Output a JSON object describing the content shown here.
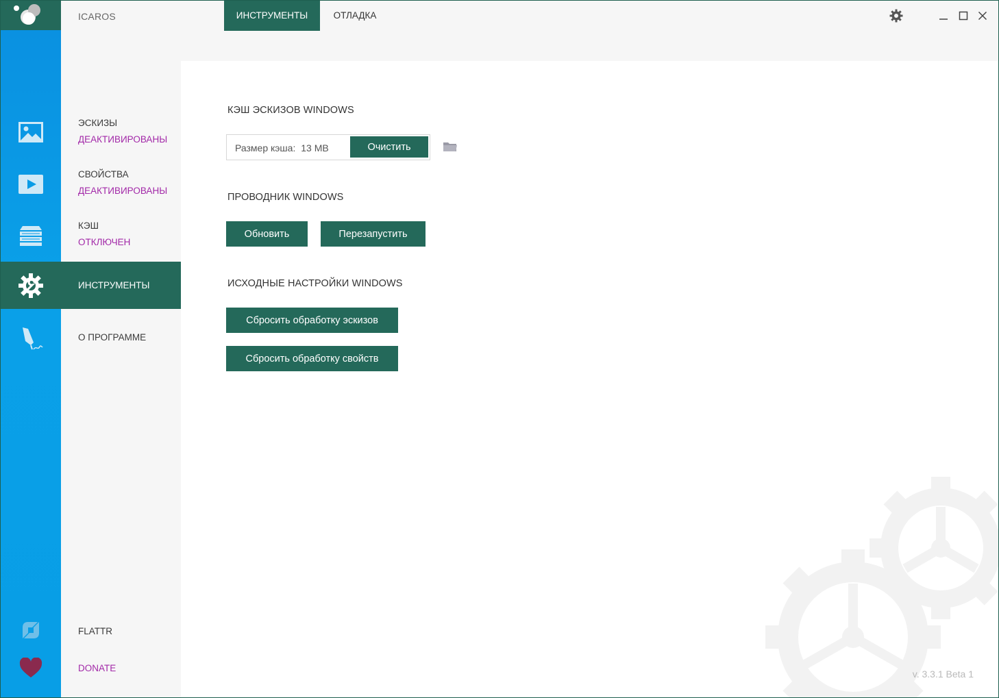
{
  "app": {
    "title": "ICAROS"
  },
  "window_controls": {
    "settings_icon": "gear-icon",
    "minimize_icon": "minimize-icon",
    "maximize_icon": "maximize-icon",
    "close_icon": "close-icon"
  },
  "nav": {
    "thumbnails": {
      "label": "ЭСКИЗЫ",
      "status": "ДЕАКТИВИРОВАНЫ"
    },
    "properties": {
      "label": "СВОЙСТВА",
      "status": "ДЕАКТИВИРОВАНЫ"
    },
    "cache": {
      "label": "КЭШ",
      "status": "ОТКЛЮЧЕН"
    },
    "tools": {
      "label": "ИНСТРУМЕНТЫ"
    },
    "about": {
      "label": "О ПРОГРАММЕ"
    },
    "flattr": {
      "label": "FLATTR"
    },
    "donate": {
      "label": "DONATE"
    }
  },
  "tabs": [
    {
      "label": "ИНСТРУМЕНТЫ",
      "active": true
    },
    {
      "label": "ОТЛАДКА",
      "active": false
    }
  ],
  "content": {
    "cache_section": {
      "title": "КЭШ ЭСКИЗОВ WINDOWS",
      "size_label": "Размер кэша:",
      "size_value": "13 MB",
      "clear_button": "Очистить"
    },
    "explorer_section": {
      "title": "ПРОВОДНИК WINDOWS",
      "refresh_button": "Обновить",
      "restart_button": "Перезапустить"
    },
    "defaults_section": {
      "title": "ИСХОДНЫЕ НАСТРОЙКИ WINDOWS",
      "reset_thumbnails_button": "Сбросить обработку эскизов",
      "reset_properties_button": "Сбросить обработку свойств"
    }
  },
  "version": "v. 3.3.1 Beta 1",
  "colors": {
    "accent": "#24695a",
    "rail": "#0aa0e8",
    "status": "#a228a8"
  }
}
